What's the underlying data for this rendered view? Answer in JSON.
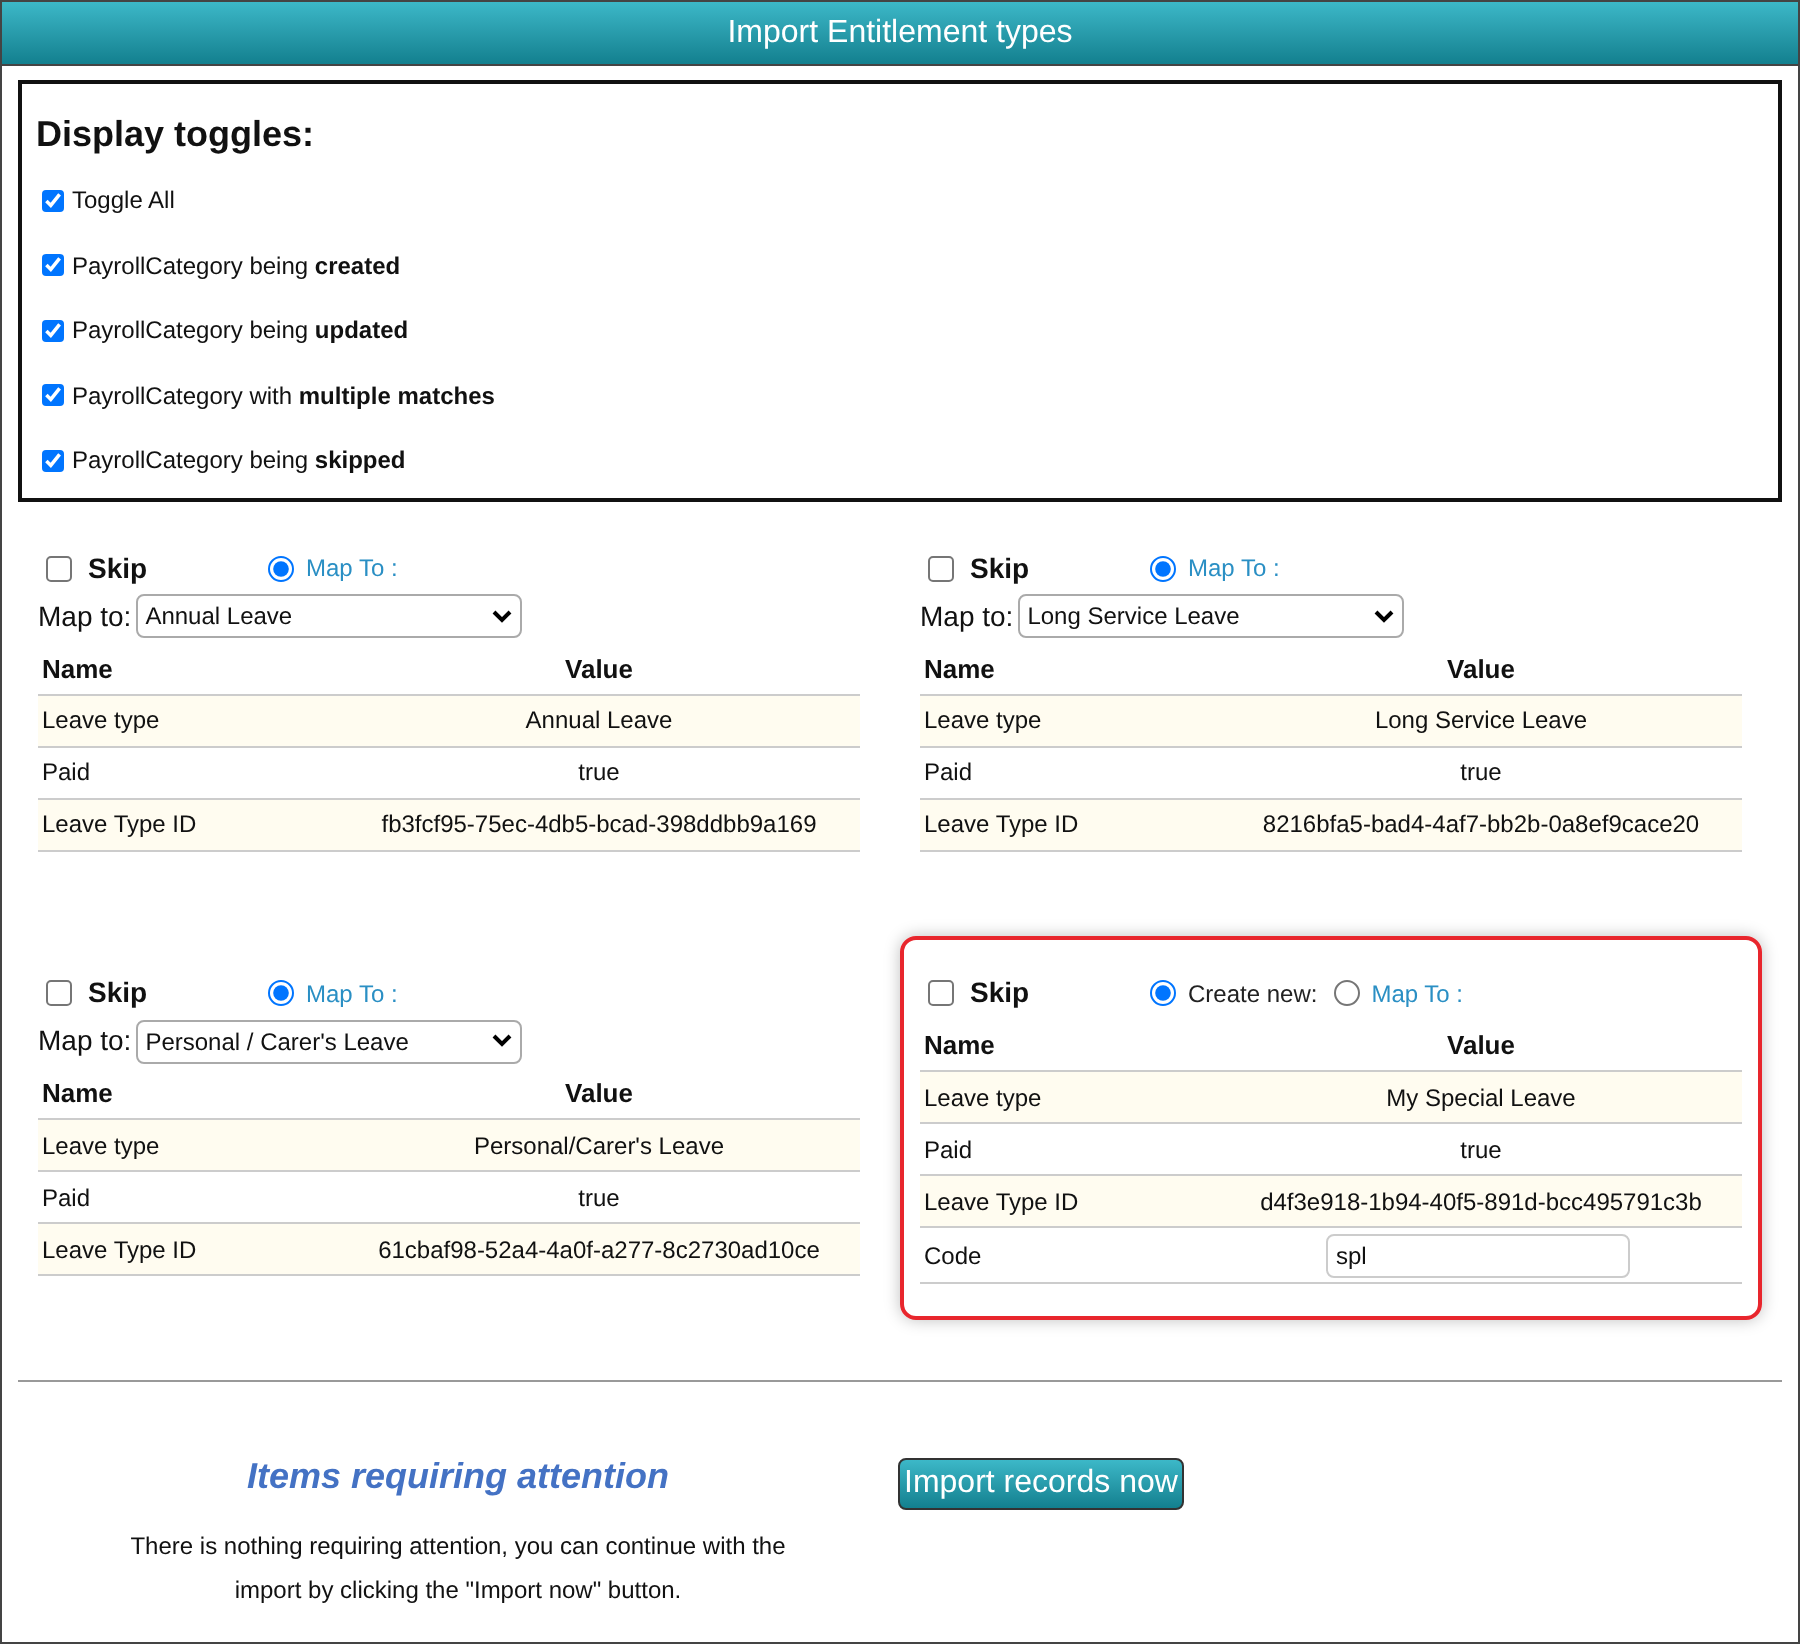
{
  "window": {
    "title": "Import Entitlement types"
  },
  "toggles": {
    "heading": "Display toggles:",
    "items": [
      {
        "label": "Toggle All",
        "checked": true
      },
      {
        "label": "PayrollCategory being **created**",
        "checked": true
      },
      {
        "label": "PayrollCategory being **updated**",
        "checked": true
      },
      {
        "label": "PayrollCategory with **multiple matches**",
        "checked": true
      },
      {
        "label": "PayrollCategory being **skipped**",
        "checked": true
      }
    ]
  },
  "cards": [
    {
      "highlighted": false,
      "skip": {
        "label": "Skip",
        "checked": false
      },
      "options": [
        {
          "kind": "map",
          "label": "Map To :",
          "selected": true
        }
      ],
      "map_to": {
        "label": "Map to:",
        "value": "Annual Leave"
      },
      "columns": [
        "Name",
        "Value"
      ],
      "rows": [
        {
          "name": "Leave type",
          "value": "Annual Leave"
        },
        {
          "name": "Paid",
          "value": "true"
        },
        {
          "name": "Leave Type ID",
          "value": "fb3fcf95-75ec-4db5-bcad-398ddbb9a169"
        }
      ]
    },
    {
      "highlighted": false,
      "skip": {
        "label": "Skip",
        "checked": false
      },
      "options": [
        {
          "kind": "map",
          "label": "Map To :",
          "selected": true
        }
      ],
      "map_to": {
        "label": "Map to:",
        "value": "Long Service Leave"
      },
      "columns": [
        "Name",
        "Value"
      ],
      "rows": [
        {
          "name": "Leave type",
          "value": "Long Service Leave"
        },
        {
          "name": "Paid",
          "value": "true"
        },
        {
          "name": "Leave Type ID",
          "value": "8216bfa5-bad4-4af7-bb2b-0a8ef9cace20"
        }
      ]
    },
    {
      "highlighted": false,
      "skip": {
        "label": "Skip",
        "checked": false
      },
      "options": [
        {
          "kind": "map",
          "label": "Map To :",
          "selected": true
        }
      ],
      "map_to": {
        "label": "Map to:",
        "value": "Personal / Carer's Leave"
      },
      "columns": [
        "Name",
        "Value"
      ],
      "rows": [
        {
          "name": "Leave type",
          "value": "Personal/Carer's Leave"
        },
        {
          "name": "Paid",
          "value": "true"
        },
        {
          "name": "Leave Type ID",
          "value": "61cbaf98-52a4-4a0f-a277-8c2730ad10ce"
        }
      ]
    },
    {
      "highlighted": true,
      "skip": {
        "label": "Skip",
        "checked": false
      },
      "options": [
        {
          "kind": "create",
          "label": "Create new:",
          "selected": true
        },
        {
          "kind": "map",
          "label": "Map To :",
          "selected": false
        }
      ],
      "columns": [
        "Name",
        "Value"
      ],
      "rows": [
        {
          "name": "Leave type",
          "value": "My Special Leave"
        },
        {
          "name": "Paid",
          "value": "true"
        },
        {
          "name": "Leave Type ID",
          "value": "d4f3e918-1b94-40f5-891d-bcc495791c3b"
        }
      ],
      "code": {
        "label": "Code",
        "value": "spl"
      }
    }
  ],
  "attention": {
    "title": "Items requiring attention",
    "message": "There is nothing requiring attention, you can continue with the import by clicking the \"Import now\" button."
  },
  "import_button": "Import records now"
}
